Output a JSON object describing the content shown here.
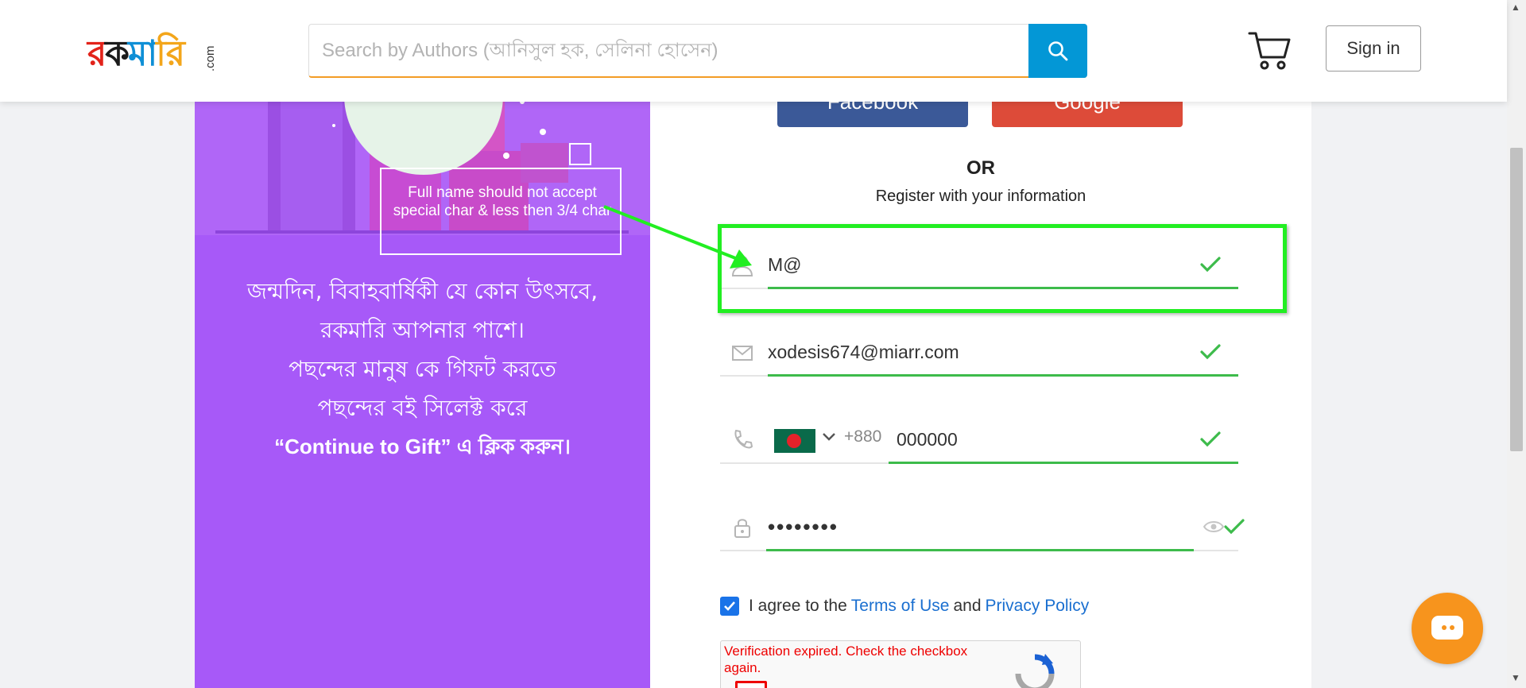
{
  "header": {
    "logo_text_parts": [
      "র",
      "ক",
      "মা",
      "রি"
    ],
    "logo_suffix": ".com",
    "search_placeholder": "Search by Authors (আনিসুল হক, সেলিনা হোসেন)",
    "signin_label": "Sign in"
  },
  "promo": {
    "lines": [
      "জন্মদিন, বিবাহবার্ষিকী যে কোন উৎসবে,",
      "রকমারি আপনার পাশে।",
      "পছন্দের মানুষ কে গিফট করতে",
      "পছন্দের বই সিলেক্ট করে"
    ],
    "last_line": "“Continue to Gift” এ ক্লিক করুন।"
  },
  "annotation": {
    "note": "Full name should not accept special char & less then 3/4 char"
  },
  "form": {
    "facebook_label": "Facebook",
    "google_label": "Google",
    "or_label": "OR",
    "subtitle": "Register with your information",
    "name_value": "M@",
    "email_value": "xodesis674@miarr.com",
    "dial_code": "+880",
    "phone_value": "000000",
    "password_value": "••••••••",
    "agree_prefix": "I agree to the",
    "terms_label": "Terms of Use",
    "and_label": "and",
    "privacy_label": "Privacy Policy",
    "captcha_error": "Verification expired. Check the checkbox again."
  },
  "colors": {
    "brand_blue": "#0397d6",
    "accent_orange": "#f39c25",
    "promo_purple": "#a759f8",
    "valid_green": "#3dbb4b",
    "highlight_green": "#22ee22",
    "facebook_blue": "#3b5998",
    "google_red": "#dd4b39",
    "error_red": "#e00000"
  }
}
